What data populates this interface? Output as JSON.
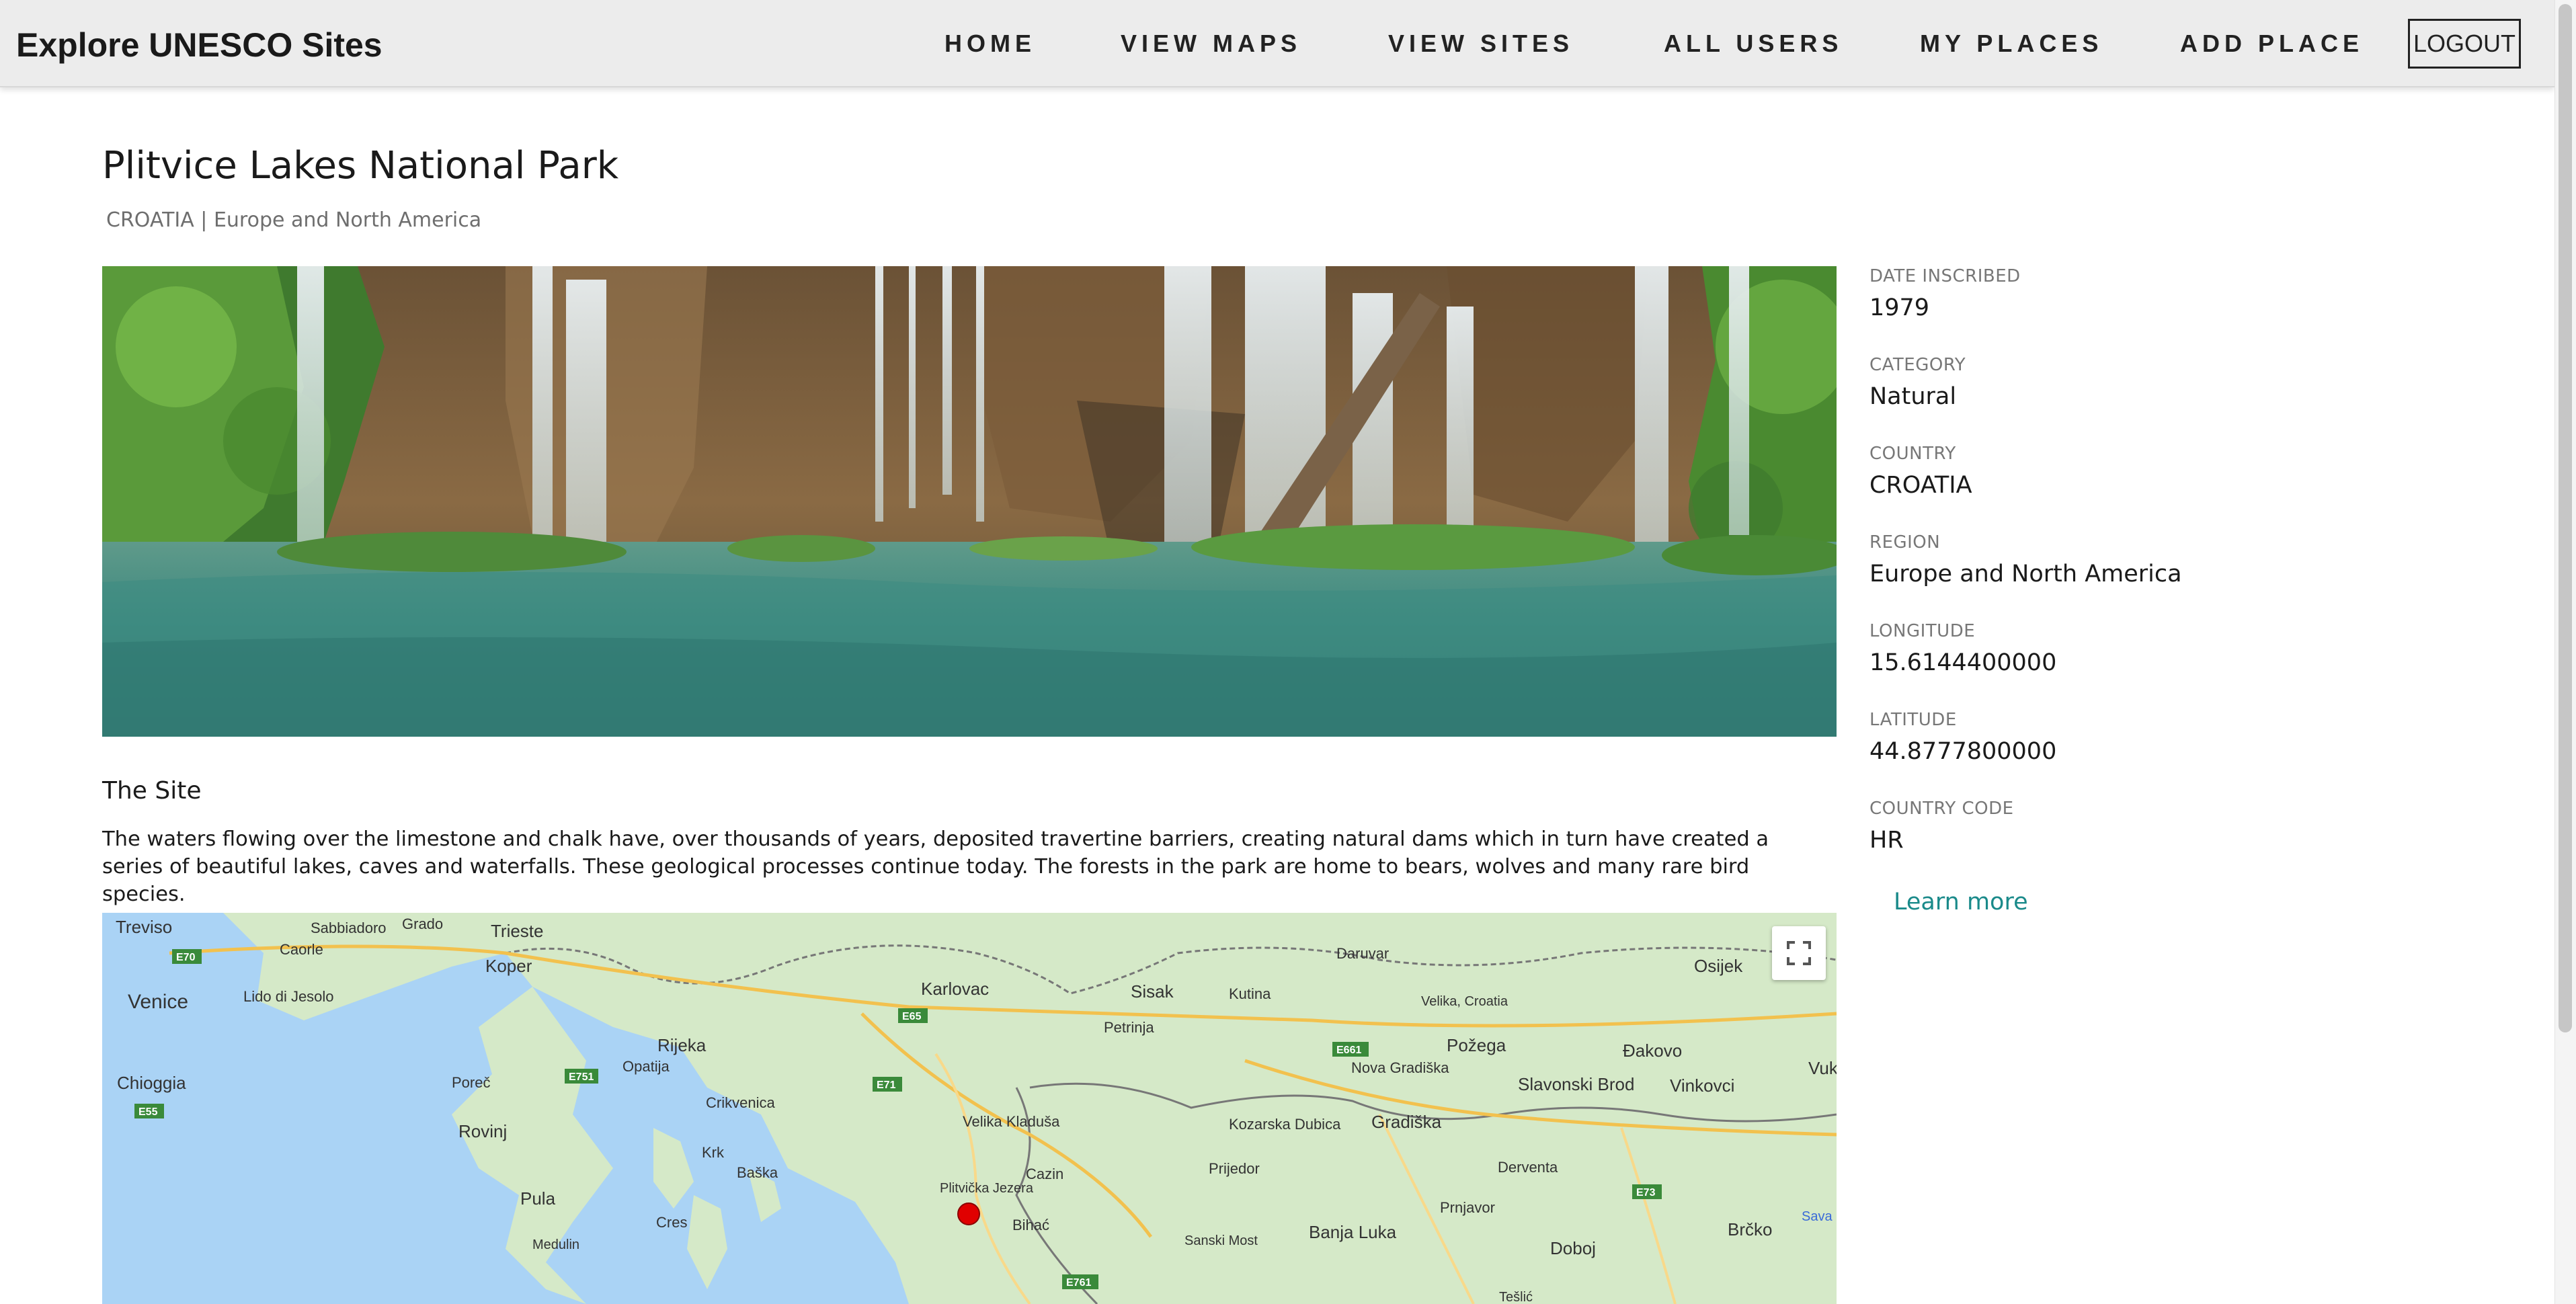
{
  "navbar": {
    "brand": "Explore UNESCO Sites",
    "items": [
      {
        "label": "HOME"
      },
      {
        "label": "VIEW MAPS"
      },
      {
        "label": "VIEW SITES"
      },
      {
        "label": "ALL USERS"
      },
      {
        "label": "MY PLACES"
      },
      {
        "label": "ADD PLACE"
      }
    ],
    "logout_label": "LOGOUT"
  },
  "site": {
    "title": "Plitvice Lakes National Park",
    "subtitle": "CROATIA | Europe and North America",
    "section_heading": "The Site",
    "description": "The waters flowing over the limestone and chalk have, over thousands of years, deposited travertine barriers, creating natural dams which in turn have created a series of beautiful lakes, caves and waterfalls. These geological processes continue today. The forests in the park are home to bears, wolves and many rare bird species.",
    "learn_more": "Learn more"
  },
  "details": [
    {
      "label": "DATE INSCRIBED",
      "value": "1979"
    },
    {
      "label": "CATEGORY",
      "value": "Natural"
    },
    {
      "label": "COUNTRY",
      "value": "CROATIA"
    },
    {
      "label": "REGION",
      "value": "Europe and North America"
    },
    {
      "label": "LONGITUDE",
      "value": "15.6144400000"
    },
    {
      "label": "LATITUDE",
      "value": "44.8777800000"
    },
    {
      "label": "COUNTRY CODE",
      "value": "HR"
    }
  ],
  "map": {
    "places": [
      "Treviso",
      "Sabbiadoro",
      "Grado",
      "Trieste",
      "Caorle",
      "Koper",
      "Venice",
      "Lido di Jesolo",
      "Chioggia",
      "Poreč",
      "Opatija",
      "Rijeka",
      "Rovinj",
      "Crikvenica",
      "Krk",
      "Baška",
      "Pula",
      "Cres",
      "Medulin",
      "Karlovac",
      "Sisak",
      "Kutina",
      "Petrinja",
      "Daruvar",
      "Velika, Croatia",
      "Osijek",
      "Požega",
      "Đakovo",
      "Vukovar",
      "Vinkovci",
      "Nova Gradiška",
      "Slavonski Brod",
      "Gradiška",
      "Kozarska Dubica",
      "Prijedor",
      "Velika Kladuša",
      "Cazin",
      "Plitvička Jezera",
      "Bihać",
      "Banja Luka",
      "Sanski Most",
      "Derventa",
      "Prnjavor",
      "Doboj",
      "Brčko",
      "Tešlić",
      "Sava"
    ],
    "roads": [
      "E70",
      "E751",
      "E55",
      "E65",
      "E71",
      "E661",
      "E73",
      "E761"
    ],
    "marker_color": "#e00000"
  }
}
